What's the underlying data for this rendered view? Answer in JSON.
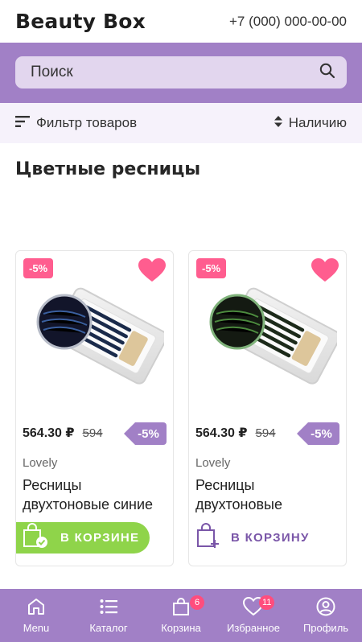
{
  "header": {
    "logo": "Beauty Box",
    "phone": "+7 (000) 000-00-00"
  },
  "search": {
    "placeholder": "Поиск",
    "icon": "search-icon"
  },
  "filter_bar": {
    "filter_label": "Фильтр товаров",
    "sort_label": "Наличию"
  },
  "page": {
    "title": "Цветные ресницы"
  },
  "products": [
    {
      "badge": "-5%",
      "price": "564.30 ₽",
      "old_price": "594",
      "discount": "-5%",
      "brand": "Lovely",
      "name": "Ресницы двухтоновые синие",
      "cart_label": "В КОРЗИНЕ",
      "in_cart": true
    },
    {
      "badge": "-5%",
      "price": "564.30 ₽",
      "old_price": "594",
      "discount": "-5%",
      "brand": "Lovely",
      "name": "Ресницы двухтоновые",
      "cart_label": "В КОРЗИНУ",
      "in_cart": false
    }
  ],
  "bottom_nav": [
    {
      "label": "Menu",
      "icon": "home-icon"
    },
    {
      "label": "Каталог",
      "icon": "list-icon"
    },
    {
      "label": "Корзина",
      "icon": "bag-icon",
      "count": "6"
    },
    {
      "label": "Избранное",
      "icon": "heart-icon",
      "count": "11"
    },
    {
      "label": "Профиль",
      "icon": "user-icon"
    }
  ],
  "colors": {
    "accent": "#a180c6",
    "pink": "#ff5d8f",
    "green": "#8fd44a",
    "purple_text": "#7a56a8"
  }
}
